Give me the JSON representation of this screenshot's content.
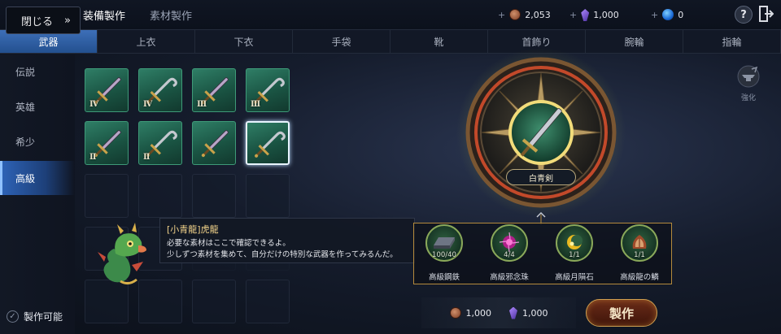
{
  "topbar": {
    "close_label": "閉じる",
    "close_chevron": "»",
    "tab_active": "装備製作",
    "tab_inactive": "素材製作",
    "currencies": [
      {
        "icon": "copper-coin-icon",
        "plus": "+",
        "value": "2,053"
      },
      {
        "icon": "purple-crystal-icon",
        "plus": "+",
        "value": "1,000"
      },
      {
        "icon": "blue-orb-icon",
        "plus": "+",
        "value": "0"
      }
    ],
    "help_label": "?"
  },
  "categories": [
    {
      "label": "武器",
      "active": true
    },
    {
      "label": "上衣",
      "active": false
    },
    {
      "label": "下衣",
      "active": false
    },
    {
      "label": "手袋",
      "active": false
    },
    {
      "label": "靴",
      "active": false
    },
    {
      "label": "首飾り",
      "active": false
    },
    {
      "label": "腕輪",
      "active": false
    },
    {
      "label": "指輪",
      "active": false
    }
  ],
  "rarities": [
    {
      "label": "伝説",
      "active": false
    },
    {
      "label": "英雄",
      "active": false
    },
    {
      "label": "希少",
      "active": false
    },
    {
      "label": "高級",
      "active": true
    }
  ],
  "craftable_filter": {
    "label": "製作可能",
    "check": "✓"
  },
  "items": [
    {
      "tier": "Ⅳ",
      "kind": "sword"
    },
    {
      "tier": "Ⅳ",
      "kind": "hook"
    },
    {
      "tier": "Ⅲ",
      "kind": "sword"
    },
    {
      "tier": "Ⅲ",
      "kind": "hook"
    },
    {
      "tier": "Ⅱ",
      "kind": "sword"
    },
    {
      "tier": "Ⅱ",
      "kind": "hook"
    },
    {
      "tier": "",
      "kind": "sword"
    },
    {
      "tier": "",
      "kind": "hook",
      "selected": true
    }
  ],
  "dialog": {
    "speaker": "[小青龍]虎龍",
    "line1": "必要な素材はここで確認できるよ。",
    "line2": "少しずつ素材を集めて、自分だけの特別な武器を作ってみるんだ。"
  },
  "selected_weapon": {
    "name": "白青剣"
  },
  "strengthen": {
    "label": "強化"
  },
  "materials": [
    {
      "name": "高級鋼鉄",
      "count": "100/40",
      "icon": "steel-ingot-icon"
    },
    {
      "name": "高級邪念珠",
      "count": "4/4",
      "icon": "evil-orb-icon"
    },
    {
      "name": "高級月隕石",
      "count": "1/1",
      "icon": "moon-meteorite-icon"
    },
    {
      "name": "高級龍の鱗",
      "count": "1/1",
      "icon": "dragon-scale-icon"
    }
  ],
  "cost": [
    {
      "icon": "copper-coin-icon",
      "value": "1,000"
    },
    {
      "icon": "purple-crystal-icon",
      "value": "1,000"
    }
  ],
  "craft_button": {
    "label": "製作"
  },
  "colors": {
    "accent_blue": "#2d62b5",
    "gold": "#b48a3c",
    "slot_green": "#1a5443"
  }
}
